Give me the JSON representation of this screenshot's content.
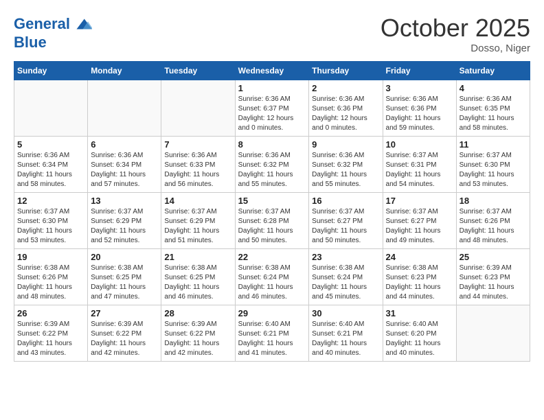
{
  "header": {
    "logo_line1": "General",
    "logo_line2": "Blue",
    "month": "October 2025",
    "location": "Dosso, Niger"
  },
  "weekdays": [
    "Sunday",
    "Monday",
    "Tuesday",
    "Wednesday",
    "Thursday",
    "Friday",
    "Saturday"
  ],
  "weeks": [
    [
      {
        "day": "",
        "info": ""
      },
      {
        "day": "",
        "info": ""
      },
      {
        "day": "",
        "info": ""
      },
      {
        "day": "1",
        "info": "Sunrise: 6:36 AM\nSunset: 6:37 PM\nDaylight: 12 hours\nand 0 minutes."
      },
      {
        "day": "2",
        "info": "Sunrise: 6:36 AM\nSunset: 6:36 PM\nDaylight: 12 hours\nand 0 minutes."
      },
      {
        "day": "3",
        "info": "Sunrise: 6:36 AM\nSunset: 6:36 PM\nDaylight: 11 hours\nand 59 minutes."
      },
      {
        "day": "4",
        "info": "Sunrise: 6:36 AM\nSunset: 6:35 PM\nDaylight: 11 hours\nand 58 minutes."
      }
    ],
    [
      {
        "day": "5",
        "info": "Sunrise: 6:36 AM\nSunset: 6:34 PM\nDaylight: 11 hours\nand 58 minutes."
      },
      {
        "day": "6",
        "info": "Sunrise: 6:36 AM\nSunset: 6:34 PM\nDaylight: 11 hours\nand 57 minutes."
      },
      {
        "day": "7",
        "info": "Sunrise: 6:36 AM\nSunset: 6:33 PM\nDaylight: 11 hours\nand 56 minutes."
      },
      {
        "day": "8",
        "info": "Sunrise: 6:36 AM\nSunset: 6:32 PM\nDaylight: 11 hours\nand 55 minutes."
      },
      {
        "day": "9",
        "info": "Sunrise: 6:36 AM\nSunset: 6:32 PM\nDaylight: 11 hours\nand 55 minutes."
      },
      {
        "day": "10",
        "info": "Sunrise: 6:37 AM\nSunset: 6:31 PM\nDaylight: 11 hours\nand 54 minutes."
      },
      {
        "day": "11",
        "info": "Sunrise: 6:37 AM\nSunset: 6:30 PM\nDaylight: 11 hours\nand 53 minutes."
      }
    ],
    [
      {
        "day": "12",
        "info": "Sunrise: 6:37 AM\nSunset: 6:30 PM\nDaylight: 11 hours\nand 53 minutes."
      },
      {
        "day": "13",
        "info": "Sunrise: 6:37 AM\nSunset: 6:29 PM\nDaylight: 11 hours\nand 52 minutes."
      },
      {
        "day": "14",
        "info": "Sunrise: 6:37 AM\nSunset: 6:29 PM\nDaylight: 11 hours\nand 51 minutes."
      },
      {
        "day": "15",
        "info": "Sunrise: 6:37 AM\nSunset: 6:28 PM\nDaylight: 11 hours\nand 50 minutes."
      },
      {
        "day": "16",
        "info": "Sunrise: 6:37 AM\nSunset: 6:27 PM\nDaylight: 11 hours\nand 50 minutes."
      },
      {
        "day": "17",
        "info": "Sunrise: 6:37 AM\nSunset: 6:27 PM\nDaylight: 11 hours\nand 49 minutes."
      },
      {
        "day": "18",
        "info": "Sunrise: 6:37 AM\nSunset: 6:26 PM\nDaylight: 11 hours\nand 48 minutes."
      }
    ],
    [
      {
        "day": "19",
        "info": "Sunrise: 6:38 AM\nSunset: 6:26 PM\nDaylight: 11 hours\nand 48 minutes."
      },
      {
        "day": "20",
        "info": "Sunrise: 6:38 AM\nSunset: 6:25 PM\nDaylight: 11 hours\nand 47 minutes."
      },
      {
        "day": "21",
        "info": "Sunrise: 6:38 AM\nSunset: 6:25 PM\nDaylight: 11 hours\nand 46 minutes."
      },
      {
        "day": "22",
        "info": "Sunrise: 6:38 AM\nSunset: 6:24 PM\nDaylight: 11 hours\nand 46 minutes."
      },
      {
        "day": "23",
        "info": "Sunrise: 6:38 AM\nSunset: 6:24 PM\nDaylight: 11 hours\nand 45 minutes."
      },
      {
        "day": "24",
        "info": "Sunrise: 6:38 AM\nSunset: 6:23 PM\nDaylight: 11 hours\nand 44 minutes."
      },
      {
        "day": "25",
        "info": "Sunrise: 6:39 AM\nSunset: 6:23 PM\nDaylight: 11 hours\nand 44 minutes."
      }
    ],
    [
      {
        "day": "26",
        "info": "Sunrise: 6:39 AM\nSunset: 6:22 PM\nDaylight: 11 hours\nand 43 minutes."
      },
      {
        "day": "27",
        "info": "Sunrise: 6:39 AM\nSunset: 6:22 PM\nDaylight: 11 hours\nand 42 minutes."
      },
      {
        "day": "28",
        "info": "Sunrise: 6:39 AM\nSunset: 6:22 PM\nDaylight: 11 hours\nand 42 minutes."
      },
      {
        "day": "29",
        "info": "Sunrise: 6:40 AM\nSunset: 6:21 PM\nDaylight: 11 hours\nand 41 minutes."
      },
      {
        "day": "30",
        "info": "Sunrise: 6:40 AM\nSunset: 6:21 PM\nDaylight: 11 hours\nand 40 minutes."
      },
      {
        "day": "31",
        "info": "Sunrise: 6:40 AM\nSunset: 6:20 PM\nDaylight: 11 hours\nand 40 minutes."
      },
      {
        "day": "",
        "info": ""
      }
    ]
  ]
}
